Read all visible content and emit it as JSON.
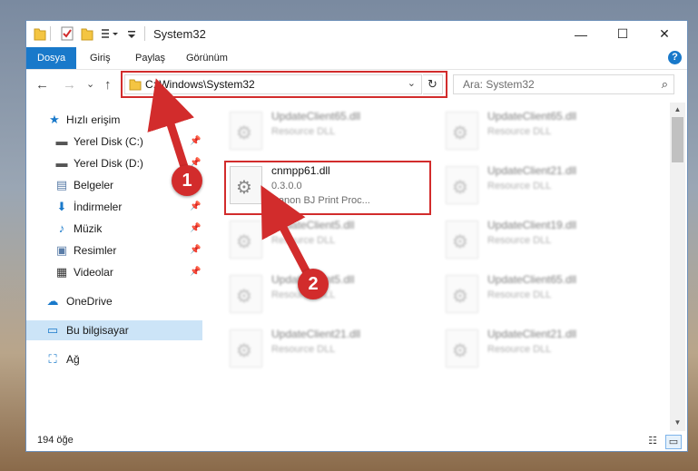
{
  "window": {
    "title": "System32",
    "controls": {
      "minimize": "—",
      "maximize": "☐",
      "close": "✕"
    }
  },
  "ribbon": {
    "tabs": [
      {
        "label": "Dosya",
        "active": true
      },
      {
        "label": "Giriş"
      },
      {
        "label": "Paylaş"
      },
      {
        "label": "Görünüm"
      }
    ],
    "help": "?"
  },
  "nav": {
    "back": "←",
    "forward": "→",
    "recent": "⌄",
    "up": "↑",
    "address": "C:\\Windows\\System32",
    "address_dropdown": "⌄",
    "refresh": "↻",
    "search_placeholder": "Ara: System32",
    "search_icon": "⌕"
  },
  "sidebar": {
    "items": [
      {
        "label": "Hızlı erişim",
        "icon": "star-icon",
        "glyph": "★",
        "color": "#1979ca"
      },
      {
        "label": "Yerel Disk (C:)",
        "icon": "drive-icon",
        "glyph": "▬",
        "color": "#555",
        "pinned": true
      },
      {
        "label": "Yerel Disk (D:)",
        "icon": "drive-icon",
        "glyph": "▬",
        "color": "#555",
        "pinned": true
      },
      {
        "label": "Belgeler",
        "icon": "documents-icon",
        "glyph": "▤",
        "color": "#5a7da8",
        "pinned": true
      },
      {
        "label": "İndirmeler",
        "icon": "download-icon",
        "glyph": "⬇",
        "color": "#1979ca",
        "pinned": true
      },
      {
        "label": "Müzik",
        "icon": "music-icon",
        "glyph": "♪",
        "color": "#1979ca",
        "pinned": true
      },
      {
        "label": "Resimler",
        "icon": "pictures-icon",
        "glyph": "▣",
        "color": "#5a7da8",
        "pinned": true
      },
      {
        "label": "Videolar",
        "icon": "video-icon",
        "glyph": "▦",
        "color": "#333",
        "pinned": true
      },
      {
        "label": "OneDrive",
        "icon": "cloud-icon",
        "glyph": "☁",
        "color": "#1979ca"
      },
      {
        "label": "Bu bilgisayar",
        "icon": "computer-icon",
        "glyph": "▭",
        "color": "#1979ca",
        "selected": true
      },
      {
        "label": "Ağ",
        "icon": "network-icon",
        "glyph": "⛶",
        "color": "#1979ca"
      }
    ],
    "pin_glyph": "📌"
  },
  "files": [
    {
      "name": "UpdateClient65.dll",
      "sub1": "Resource DLL",
      "blurred": true
    },
    {
      "name": "UpdateClient65.dll",
      "sub1": "Resource DLL",
      "blurred": true
    },
    {
      "name": "cnmpp61.dll",
      "sub1": "0.3.0.0",
      "sub2": "Canon BJ Print Proc...",
      "blurred": false,
      "highlighted": true
    },
    {
      "name": "UpdateClient21.dll",
      "sub1": "Resource DLL",
      "blurred": true
    },
    {
      "name": "UpdateClient5.dll",
      "sub1": "Resource DLL",
      "blurred": true
    },
    {
      "name": "UpdateClient19.dll",
      "sub1": "Resource DLL",
      "blurred": true
    },
    {
      "name": "UpdateClient5.dll",
      "sub1": "Resource DLL",
      "blurred": true
    },
    {
      "name": "UpdateClient65.dll",
      "sub1": "Resource DLL",
      "blurred": true
    },
    {
      "name": "UpdateClient21.dll",
      "sub1": "Resource DLL",
      "blurred": true
    },
    {
      "name": "UpdateClient21.dll",
      "sub1": "Resource DLL",
      "blurred": true
    }
  ],
  "status": {
    "item_count": "194 öğe"
  },
  "annotations": {
    "callout1": "1",
    "callout2": "2",
    "color": "#d22c2c"
  }
}
